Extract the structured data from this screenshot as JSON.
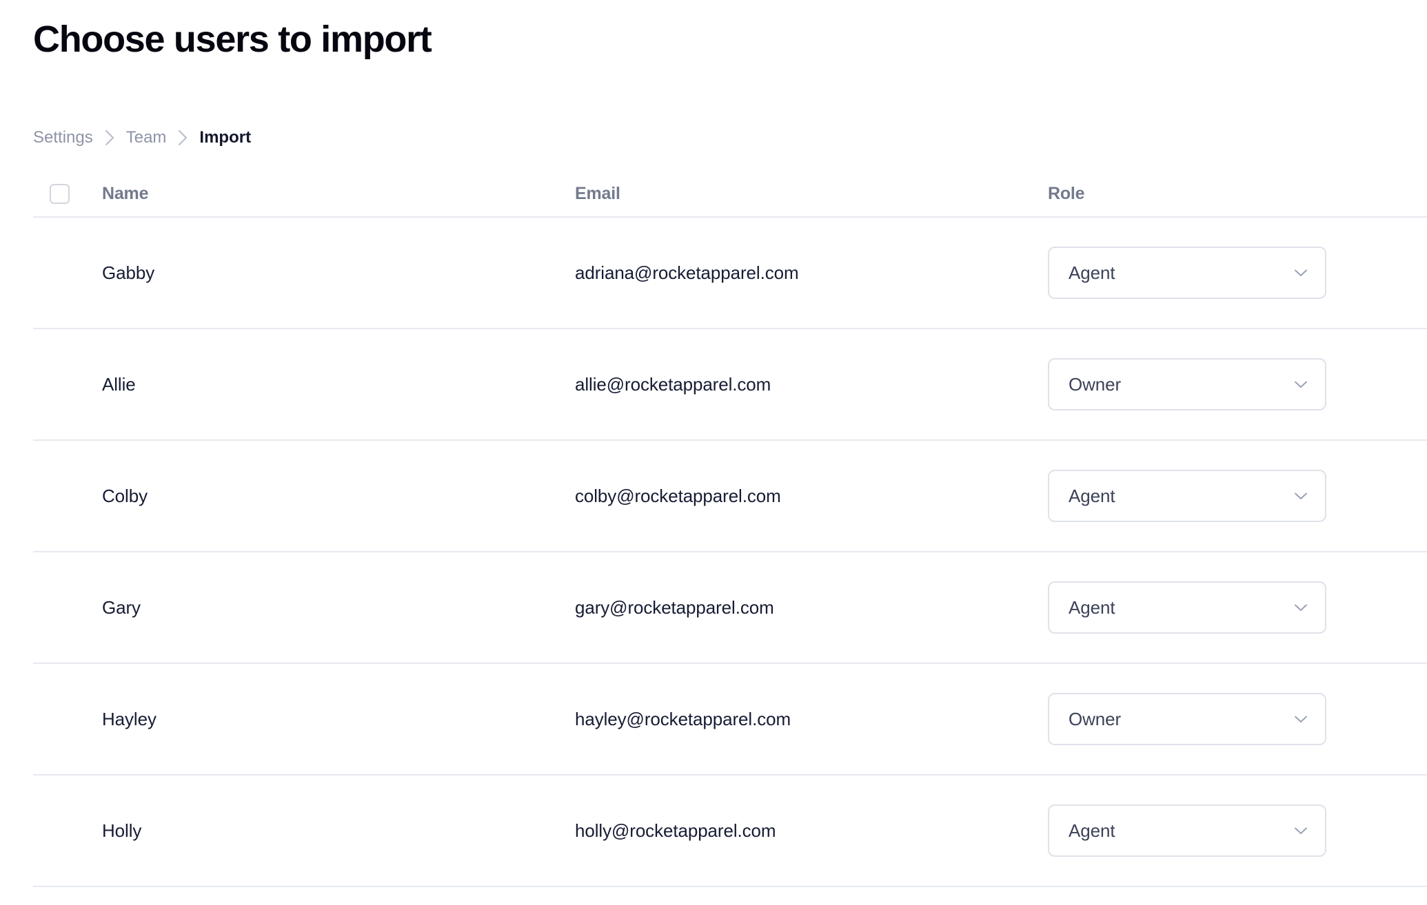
{
  "page": {
    "title": "Choose users to import"
  },
  "breadcrumb": {
    "separator_icon": "chevron-right-icon",
    "items": [
      {
        "label": "Settings",
        "current": false
      },
      {
        "label": "Team",
        "current": false
      },
      {
        "label": "Import",
        "current": true
      }
    ]
  },
  "table": {
    "select_all": {
      "checked": false,
      "icon": "checkbox-unchecked-icon"
    },
    "columns": {
      "name": "Name",
      "email": "Email",
      "role": "Role"
    },
    "role_select": {
      "chevron_icon": "chevron-down-icon",
      "options": [
        "Agent",
        "Owner"
      ]
    },
    "rows": [
      {
        "name": "Gabby",
        "email": "adriana@rocketapparel.com",
        "role": "Agent",
        "checked": false
      },
      {
        "name": "Allie",
        "email": "allie@rocketapparel.com",
        "role": "Owner",
        "checked": false
      },
      {
        "name": "Colby",
        "email": "colby@rocketapparel.com",
        "role": "Agent",
        "checked": false
      },
      {
        "name": "Gary",
        "email": "gary@rocketapparel.com",
        "role": "Agent",
        "checked": false
      },
      {
        "name": "Hayley",
        "email": "hayley@rocketapparel.com",
        "role": "Owner",
        "checked": false
      },
      {
        "name": "Holly",
        "email": "holly@rocketapparel.com",
        "role": "Agent",
        "checked": false
      }
    ]
  },
  "colors": {
    "title": "#05060f",
    "text": "#161c33",
    "muted": "#8d94a6",
    "header": "#737a8c",
    "border": "#dfe2e9",
    "divider": "#e7e9f0",
    "background": "#ffffff"
  }
}
